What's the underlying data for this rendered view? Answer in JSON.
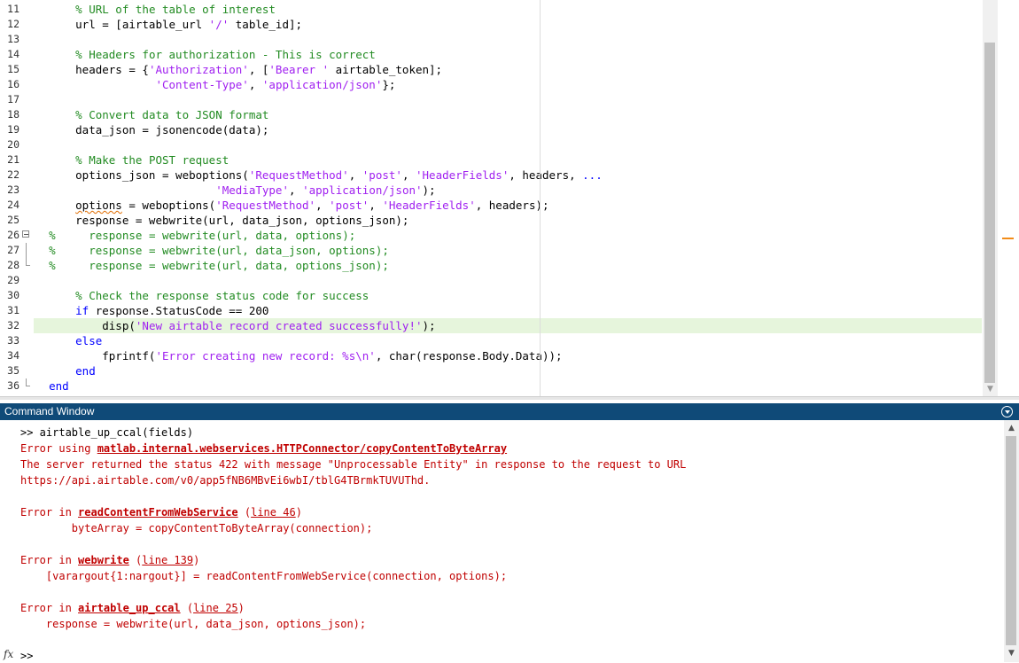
{
  "editor": {
    "lines": [
      {
        "n": "11",
        "segs": [
          [
            "      ",
            ""
          ],
          [
            "% URL of the table of interest",
            "c"
          ]
        ]
      },
      {
        "n": "12",
        "segs": [
          [
            "      url = [airtable_url ",
            ""
          ],
          [
            "'/'",
            "s"
          ],
          [
            " table_id];",
            ""
          ]
        ]
      },
      {
        "n": "13",
        "segs": []
      },
      {
        "n": "14",
        "segs": [
          [
            "      ",
            ""
          ],
          [
            "% Headers for authorization - This is correct",
            "c"
          ]
        ]
      },
      {
        "n": "15",
        "segs": [
          [
            "      headers = {",
            ""
          ],
          [
            "'Authorization'",
            "s"
          ],
          [
            ", [",
            ""
          ],
          [
            "'Bearer '",
            "s"
          ],
          [
            " airtable_token];",
            ""
          ]
        ]
      },
      {
        "n": "16",
        "segs": [
          [
            "                  ",
            ""
          ],
          [
            "'Content-Type'",
            "s"
          ],
          [
            ", ",
            ""
          ],
          [
            "'application/json'",
            "s"
          ],
          [
            "};",
            ""
          ]
        ]
      },
      {
        "n": "17",
        "segs": []
      },
      {
        "n": "18",
        "segs": [
          [
            "      ",
            ""
          ],
          [
            "% Convert data to JSON format",
            "c"
          ]
        ]
      },
      {
        "n": "19",
        "segs": [
          [
            "      data_json = jsonencode(data);",
            ""
          ]
        ]
      },
      {
        "n": "20",
        "segs": []
      },
      {
        "n": "21",
        "segs": [
          [
            "      ",
            ""
          ],
          [
            "% Make the POST request",
            "c"
          ]
        ]
      },
      {
        "n": "22",
        "segs": [
          [
            "      options_json = weboptions(",
            ""
          ],
          [
            "'RequestMethod'",
            "s"
          ],
          [
            ", ",
            ""
          ],
          [
            "'post'",
            "s"
          ],
          [
            ", ",
            ""
          ],
          [
            "'HeaderFields'",
            "s"
          ],
          [
            ", headers, ",
            ""
          ],
          [
            "...",
            "k"
          ]
        ]
      },
      {
        "n": "23",
        "segs": [
          [
            "                           ",
            ""
          ],
          [
            "'MediaType'",
            "s"
          ],
          [
            ", ",
            ""
          ],
          [
            "'application/json'",
            "s"
          ],
          [
            ");",
            ""
          ]
        ]
      },
      {
        "n": "24",
        "segs": [
          [
            "      ",
            ""
          ],
          [
            "options",
            "u"
          ],
          [
            " = weboptions(",
            ""
          ],
          [
            "'RequestMethod'",
            "s"
          ],
          [
            ", ",
            ""
          ],
          [
            "'post'",
            "s"
          ],
          [
            ", ",
            ""
          ],
          [
            "'HeaderFields'",
            "s"
          ],
          [
            ", headers);",
            ""
          ]
        ]
      },
      {
        "n": "25",
        "segs": [
          [
            "      response = webwrite(url, data_json, options_json);",
            ""
          ]
        ]
      },
      {
        "n": "26",
        "fold": "box",
        "segs": [
          [
            "  ",
            ""
          ],
          [
            "%     response = webwrite(url, data, options);",
            "c"
          ]
        ]
      },
      {
        "n": "27",
        "fold": "vline",
        "segs": [
          [
            "  ",
            ""
          ],
          [
            "%     response = webwrite(url, data_json, options);",
            "c"
          ]
        ]
      },
      {
        "n": "28",
        "fold": "end",
        "segs": [
          [
            "  ",
            ""
          ],
          [
            "%     response = webwrite(url, data, options_json);",
            "c"
          ]
        ]
      },
      {
        "n": "29",
        "segs": []
      },
      {
        "n": "30",
        "segs": [
          [
            "      ",
            ""
          ],
          [
            "% Check the response status code for success",
            "c"
          ]
        ]
      },
      {
        "n": "31",
        "segs": [
          [
            "      ",
            ""
          ],
          [
            "if",
            "k"
          ],
          [
            " response.StatusCode == 200",
            ""
          ]
        ]
      },
      {
        "n": "32",
        "hl": true,
        "segs": [
          [
            "          disp(",
            ""
          ],
          [
            "'New airtable record created successfully!'",
            "s"
          ],
          [
            ");",
            ""
          ]
        ]
      },
      {
        "n": "33",
        "segs": [
          [
            "      ",
            ""
          ],
          [
            "else",
            "k"
          ]
        ]
      },
      {
        "n": "34",
        "segs": [
          [
            "          fprintf(",
            ""
          ],
          [
            "'Error creating new record: %s\\n'",
            "s"
          ],
          [
            ", char(response.Body.Data));",
            ""
          ]
        ]
      },
      {
        "n": "35",
        "segs": [
          [
            "      ",
            ""
          ],
          [
            "end",
            "k"
          ]
        ]
      },
      {
        "n": "36",
        "fold": "endmain",
        "segs": [
          [
            "  ",
            ""
          ],
          [
            "end",
            "k"
          ]
        ]
      }
    ]
  },
  "command_window": {
    "title": "Command Window",
    "command": ">> airtable_up_ccal(fields)",
    "err1_prefix": "Error using ",
    "err1_link": "matlab.internal.webservices.HTTPConnector/copyContentToByteArray",
    "err1_msg1": "The server returned the status 422 with message \"Unprocessable Entity\" in response to the request to URL",
    "err1_msg2": "https://api.airtable.com/v0/app5fNB6MBvEi6wbI/tblG4TBrmkTUVUThd.",
    "err2_prefix": "Error in ",
    "err2_link": "readContentFromWebService",
    "err2_line": "line 46",
    "err2_code": "        byteArray = copyContentToByteArray(connection);",
    "err3_prefix": "Error in ",
    "err3_link": "webwrite",
    "err3_line": "line 139",
    "err3_code": "    [varargout{1:nargout}] = readContentFromWebService(connection, options);",
    "err4_prefix": "Error in ",
    "err4_link": "airtable_up_ccal",
    "err4_line": "line 25",
    "err4_code": "    response = webwrite(url, data_json, options_json);",
    "fx_label": "fx",
    "prompt": ">>"
  }
}
